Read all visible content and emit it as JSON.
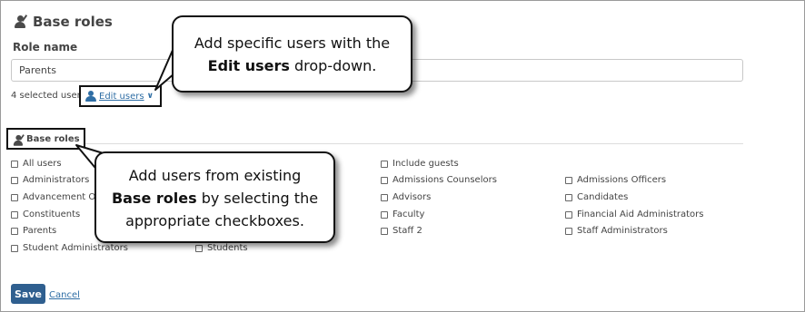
{
  "page": {
    "title": "Base roles",
    "role_name_label": "Role name",
    "role_name_value": "Parents",
    "selected_users_text": "4 selected users",
    "edit_users_link": "Edit users",
    "base_roles_section_title": "Base roles",
    "save_label": "Save",
    "cancel_label": "Cancel"
  },
  "checkboxes": {
    "col1": [
      "All users",
      "Administrators",
      "Advancement Officers",
      "Constituents",
      "Parents",
      "Student Administrators"
    ],
    "col2": [
      "Students"
    ],
    "col3": [
      "Include guests",
      "Admissions Counselors",
      "Advisors",
      "Faculty",
      "Staff 2"
    ],
    "col4": [
      "Admissions Officers",
      "Candidates",
      "Financial Aid Administrators",
      "Staff Administrators"
    ]
  },
  "callouts": {
    "top": {
      "line1": "Add specific users with the",
      "bold": "Edit users",
      "rest": " drop-down."
    },
    "bottom": {
      "line1": "Add users from existing",
      "bold": "Base roles",
      "rest": " by selecting the",
      "line3": "appropriate checkboxes."
    }
  }
}
